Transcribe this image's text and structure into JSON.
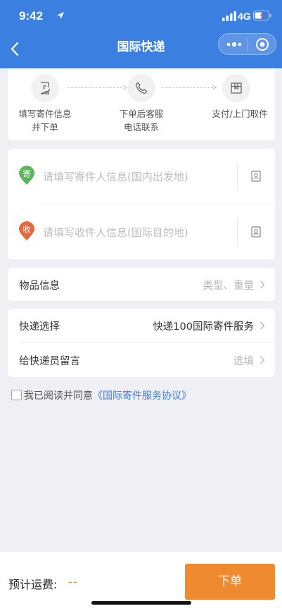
{
  "status_bar": {
    "time": "9:42",
    "network": "4G"
  },
  "nav": {
    "title": "国际快递"
  },
  "steps": [
    {
      "label_line1": "填写寄件信息",
      "label_line2": "并下单"
    },
    {
      "label_line1": "下单后客服",
      "label_line2": "电话联系"
    },
    {
      "label_line1": "支付/上门取件",
      "label_line2": ""
    }
  ],
  "sender": {
    "badge": "寄",
    "placeholder": "请填写寄件人信息(国内出发地)",
    "badge_color": "#5bb85a"
  },
  "receiver": {
    "badge": "收",
    "placeholder": "请填写收件人信息(国际目的地)",
    "badge_color": "#e8673d"
  },
  "item_info": {
    "label": "物品信息",
    "value": "类型、重量"
  },
  "express": {
    "label": "快递选择",
    "value": "快递100国际寄件服务"
  },
  "message": {
    "label": "给快递员留言",
    "value": "选填"
  },
  "agreement": {
    "prefix": "我已阅读并同意",
    "link": "《国际寄件服务协议》"
  },
  "footer": {
    "fee_label": "预计运费:",
    "fee_value": "--",
    "order_button": "下单"
  },
  "colors": {
    "header": "#3b7fe0",
    "accent": "#f08a31"
  }
}
